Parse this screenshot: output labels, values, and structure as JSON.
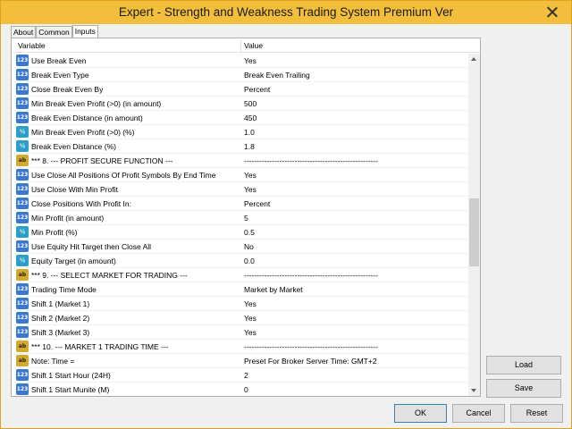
{
  "window": {
    "title": "Expert - Strength and Weakness Trading System Premium Ver"
  },
  "tabs": [
    {
      "label": "About",
      "active": false
    },
    {
      "label": "Common",
      "active": false
    },
    {
      "label": "Inputs",
      "active": true
    }
  ],
  "table": {
    "columns": {
      "variable": "Variable",
      "value": "Value"
    },
    "rows": [
      {
        "icon": "i-num",
        "icon_text": "123",
        "name": "Use Break Even",
        "value": "Yes"
      },
      {
        "icon": "i-num",
        "icon_text": "123",
        "name": "Break Even Type",
        "value": "Break Even Trailing"
      },
      {
        "icon": "i-num",
        "icon_text": "123",
        "name": "Close Break Even By",
        "value": "Percent"
      },
      {
        "icon": "i-num",
        "icon_text": "123",
        "name": "Min Break Even Profit (>0) (in amount)",
        "value": "500"
      },
      {
        "icon": "i-num",
        "icon_text": "123",
        "name": "Break Even Distance (in amount)",
        "value": "450"
      },
      {
        "icon": "i-dbl",
        "icon_text": "½",
        "name": "Min Break Even Profit (>0) (%)",
        "value": "1.0"
      },
      {
        "icon": "i-dbl",
        "icon_text": "½",
        "name": "Break Even Distance (%)",
        "value": "1.8"
      },
      {
        "icon": "i-str",
        "icon_text": "ab",
        "name": "*** 8. --- PROFIT SECURE FUNCTION ---",
        "value": "-----------------------------------------------------"
      },
      {
        "icon": "i-num",
        "icon_text": "123",
        "name": "Use Close All Positions Of Profit Symbols By End Time",
        "value": "Yes"
      },
      {
        "icon": "i-num",
        "icon_text": "123",
        "name": "Use Close With Min Profit",
        "value": "Yes"
      },
      {
        "icon": "i-num",
        "icon_text": "123",
        "name": "Close Positions With Profit In:",
        "value": "Percent"
      },
      {
        "icon": "i-num",
        "icon_text": "123",
        "name": "Min Profit (in amount)",
        "value": "5"
      },
      {
        "icon": "i-dbl",
        "icon_text": "½",
        "name": "Min Profit (%)",
        "value": "0.5"
      },
      {
        "icon": "i-num",
        "icon_text": "123",
        "name": "Use Equity Hit Target then Close All",
        "value": "No"
      },
      {
        "icon": "i-dbl",
        "icon_text": "½",
        "name": "Equity Target (in amount)",
        "value": "0.0"
      },
      {
        "icon": "i-str",
        "icon_text": "ab",
        "name": "*** 9. --- SELECT MARKET FOR TRADING ---",
        "value": "-----------------------------------------------------"
      },
      {
        "icon": "i-num",
        "icon_text": "123",
        "name": "Trading Time Mode",
        "value": "Market by Market"
      },
      {
        "icon": "i-num",
        "icon_text": "123",
        "name": "Shift 1 (Market 1)",
        "value": "Yes"
      },
      {
        "icon": "i-num",
        "icon_text": "123",
        "name": "Shift 2 (Market 2)",
        "value": "Yes"
      },
      {
        "icon": "i-num",
        "icon_text": "123",
        "name": "Shift 3 (Market 3)",
        "value": "Yes"
      },
      {
        "icon": "i-str",
        "icon_text": "ab",
        "name": "*** 10. --- MARKET 1 TRADING TIME ---",
        "value": "-----------------------------------------------------"
      },
      {
        "icon": "i-str",
        "icon_text": "ab",
        "name": "Note: Time =",
        "value": "Preset For Broker Server Time: GMT+2"
      },
      {
        "icon": "i-num",
        "icon_text": "123",
        "name": "Shift 1 Start Hour (24H)",
        "value": "2"
      },
      {
        "icon": "i-num",
        "icon_text": "123",
        "name": "Shift 1 Start Munite (M)",
        "value": "0"
      }
    ]
  },
  "buttons": {
    "load": "Load",
    "save": "Save",
    "ok": "OK",
    "cancel": "Cancel",
    "reset": "Reset"
  }
}
